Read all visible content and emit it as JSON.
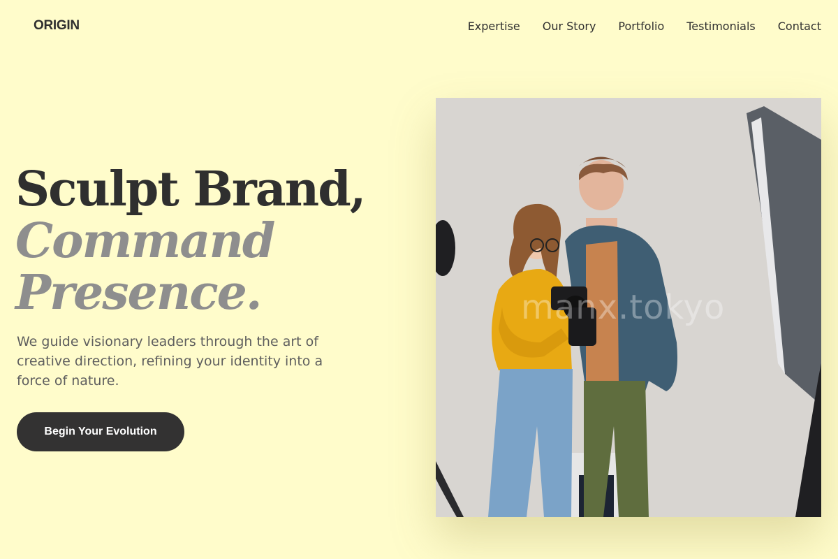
{
  "header": {
    "logo": "ORIGIN",
    "nav": [
      "Expertise",
      "Our Story",
      "Portfolio",
      "Testimonials",
      "Contact"
    ]
  },
  "hero": {
    "headline_line1": "Sculpt Brand,",
    "headline_line2": "Command",
    "headline_line3": "Presence.",
    "description": "We guide visionary leaders through the art of creative direction, refining your identity into a force of nature.",
    "cta_label": "Begin Your Evolution",
    "image_watermark": "manx.tokyo"
  },
  "colors": {
    "background": "#fffccb",
    "text_dark": "#2f2f2f",
    "text_muted": "#8e8e8e",
    "button_bg": "#333232"
  }
}
